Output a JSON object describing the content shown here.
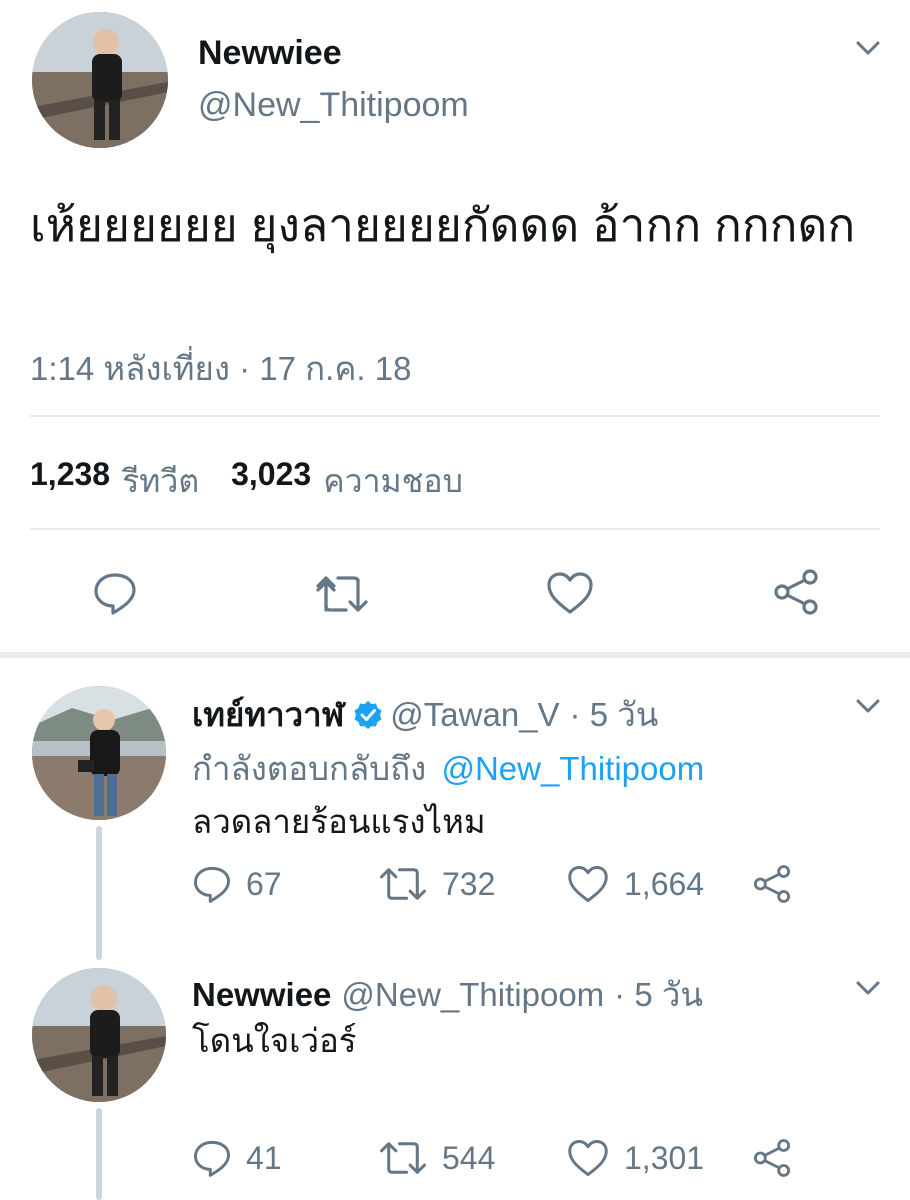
{
  "main_tweet": {
    "display_name": "Newwiee",
    "handle": "@New_Thitipoom",
    "text": "เห้ยยยยยย ยุงลายยยยกัดดด อ้ากก กกกดก",
    "timestamp": "1:14 หลังเที่ยง · 17 ก.ค. 18",
    "retweets_count": "1,238",
    "retweets_label": "รีทวีต",
    "likes_count": "3,023",
    "likes_label": "ความชอบ",
    "icons": [
      "reply-icon",
      "retweet-icon",
      "like-icon",
      "share-icon",
      "chevron-down-icon"
    ]
  },
  "replies": [
    {
      "display_name": "เทย์ทาวาฬ",
      "verified": true,
      "handle": "@Tawan_V",
      "age": "· 5 วัน",
      "replying_to_label": "กำลังตอบกลับถึง",
      "replying_to_handle": "@New_Thitipoom",
      "text": "ลวดลายร้อนแรงไหม",
      "reply_count": "67",
      "retweet_count": "732",
      "like_count": "1,664"
    },
    {
      "display_name": "Newwiee",
      "verified": false,
      "handle": "@New_Thitipoom",
      "age": "· 5 วัน",
      "text": "โดนใจเว่อร์",
      "reply_count": "41",
      "retweet_count": "544",
      "like_count": "1,301"
    }
  ],
  "colors": {
    "text": "#14171a",
    "secondary": "#657786",
    "link": "#1da1f2",
    "divider": "#e6ecf0",
    "thread_line": "#ccd6dd"
  }
}
